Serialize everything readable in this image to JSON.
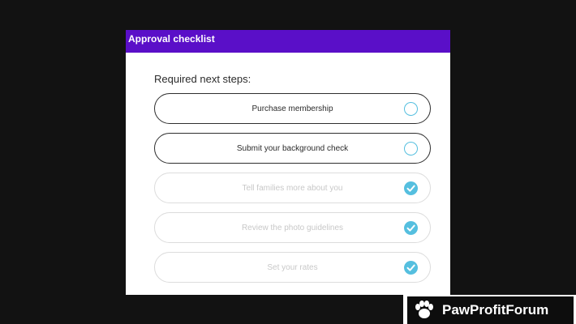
{
  "panel": {
    "title": "Approval checklist",
    "subtitle": "Required next steps:",
    "accent_color": "#5a0fc8",
    "status_color": "#55bfdf"
  },
  "steps": [
    {
      "label": "Purchase membership",
      "status": "incomplete",
      "icon": "empty-circle-icon"
    },
    {
      "label": "Submit your background check",
      "status": "incomplete",
      "icon": "empty-circle-icon"
    },
    {
      "label": "Tell families more about you",
      "status": "complete",
      "icon": "check-circle-icon"
    },
    {
      "label": "Review the photo guidelines",
      "status": "complete",
      "icon": "check-circle-icon"
    },
    {
      "label": "Set your rates",
      "status": "complete",
      "icon": "check-circle-icon"
    }
  ],
  "watermark": {
    "text": "PawProfitForum",
    "icon": "paw-icon"
  }
}
